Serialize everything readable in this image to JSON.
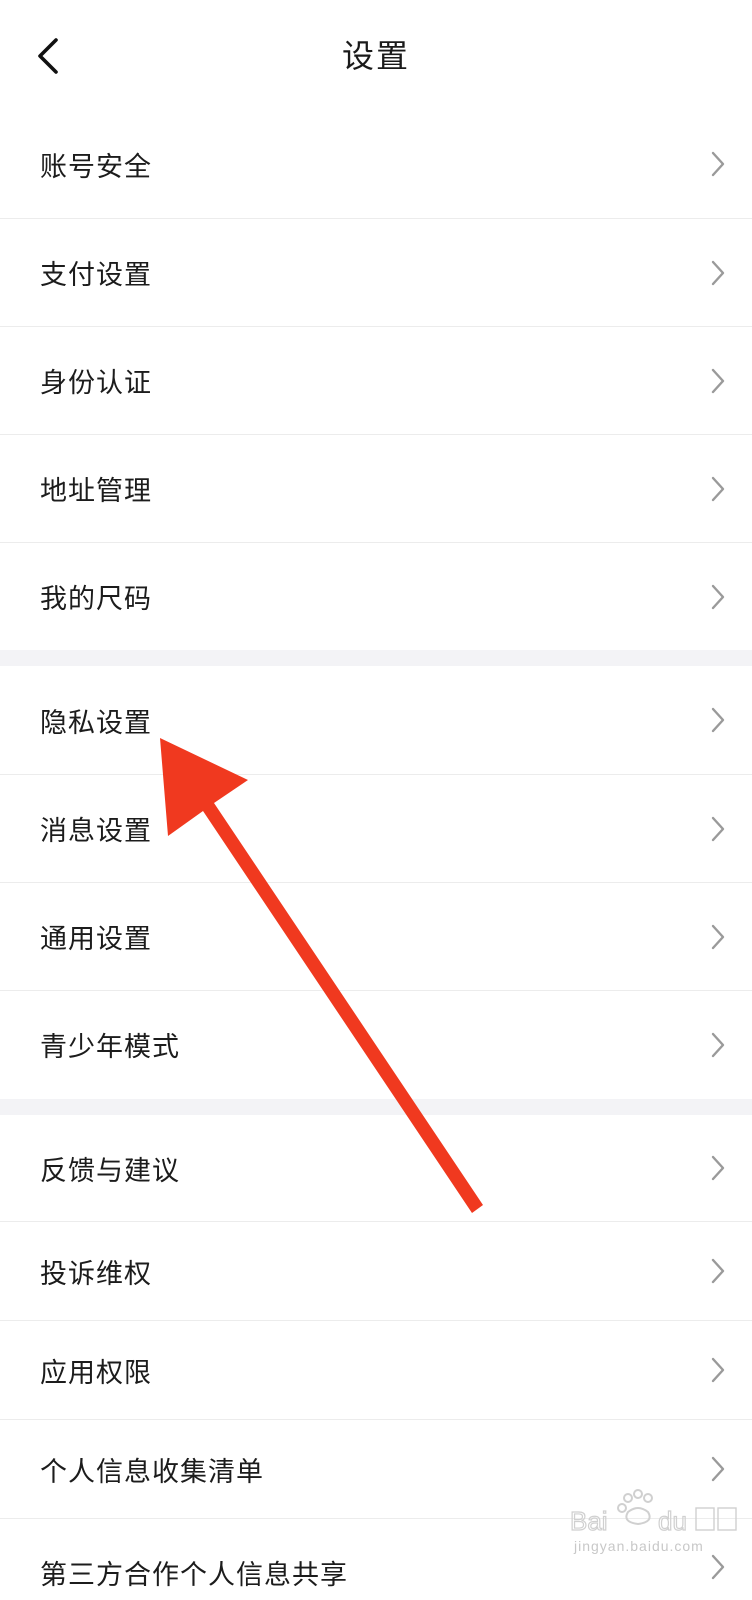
{
  "header": {
    "title": "设置"
  },
  "groups": [
    {
      "items": [
        {
          "label": "账号安全"
        },
        {
          "label": "支付设置"
        },
        {
          "label": "身份认证"
        },
        {
          "label": "地址管理"
        },
        {
          "label": "我的尺码"
        }
      ]
    },
    {
      "items": [
        {
          "label": "隐私设置"
        },
        {
          "label": "消息设置"
        },
        {
          "label": "通用设置"
        },
        {
          "label": "青少年模式"
        }
      ]
    },
    {
      "items": [
        {
          "label": "反馈与建议"
        },
        {
          "label": "投诉维权"
        },
        {
          "label": "应用权限"
        },
        {
          "label": "个人信息收集清单"
        },
        {
          "label": "第三方合作个人信息共享"
        }
      ]
    }
  ],
  "annotation": {
    "color": "#f0391f"
  },
  "watermark": {
    "text": "jingyan.baidu.com"
  }
}
